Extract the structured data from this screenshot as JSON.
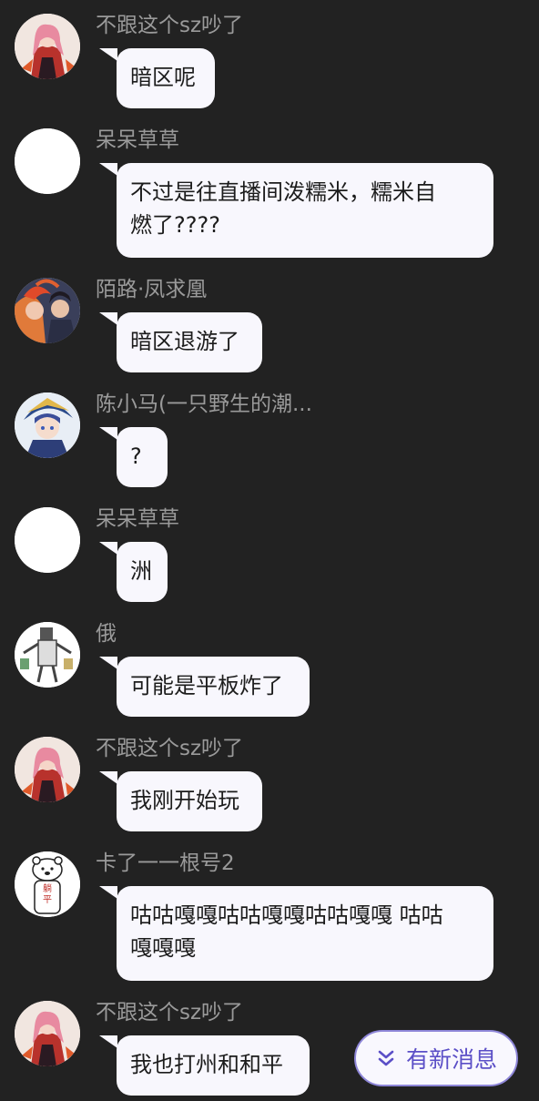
{
  "messages": [
    {
      "sender": "不跟这个sz吵了",
      "text": "暗区呢",
      "avatar": "anime-girl-red-avatar"
    },
    {
      "sender": "呆呆草草",
      "text": "不过是往直播间泼糯米，糯米自\n燃了????",
      "avatar": "blank-white-avatar"
    },
    {
      "sender": "陌路·凤求凰",
      "text": "暗区退游了",
      "avatar": "couple-avatar"
    },
    {
      "sender": "陈小马(一只野生的潮...",
      "text": "?",
      "avatar": "anime-boy-blue-avatar"
    },
    {
      "sender": "呆呆草草",
      "text": "洲",
      "avatar": "blank-white-avatar"
    },
    {
      "sender": "俄",
      "text": "可能是平板炸了",
      "avatar": "meme-figure-avatar"
    },
    {
      "sender": "不跟这个sz吵了",
      "text": "我刚开始玩",
      "avatar": "anime-girl-red-avatar"
    },
    {
      "sender": "卡了一一根号2",
      "text": "咕咕嘎嘎咕咕嘎嘎咕咕嘎嘎 咕咕\n嘎嘎嘎",
      "avatar": "lying-flat-bear-avatar"
    },
    {
      "sender": "不跟这个sz吵了",
      "text": "我也打州和和平",
      "avatar": "anime-girl-red-avatar"
    }
  ],
  "new_message_button": {
    "label": "有新消息",
    "icon": "double-chevron-down-icon"
  },
  "meme_avatar_text": {
    "char1": "躺",
    "char2": "平"
  },
  "colors": {
    "background": "#222222",
    "bubble": "#f8f7fd",
    "sender": "#9a9a9a",
    "accent": "#5b4fc7"
  }
}
